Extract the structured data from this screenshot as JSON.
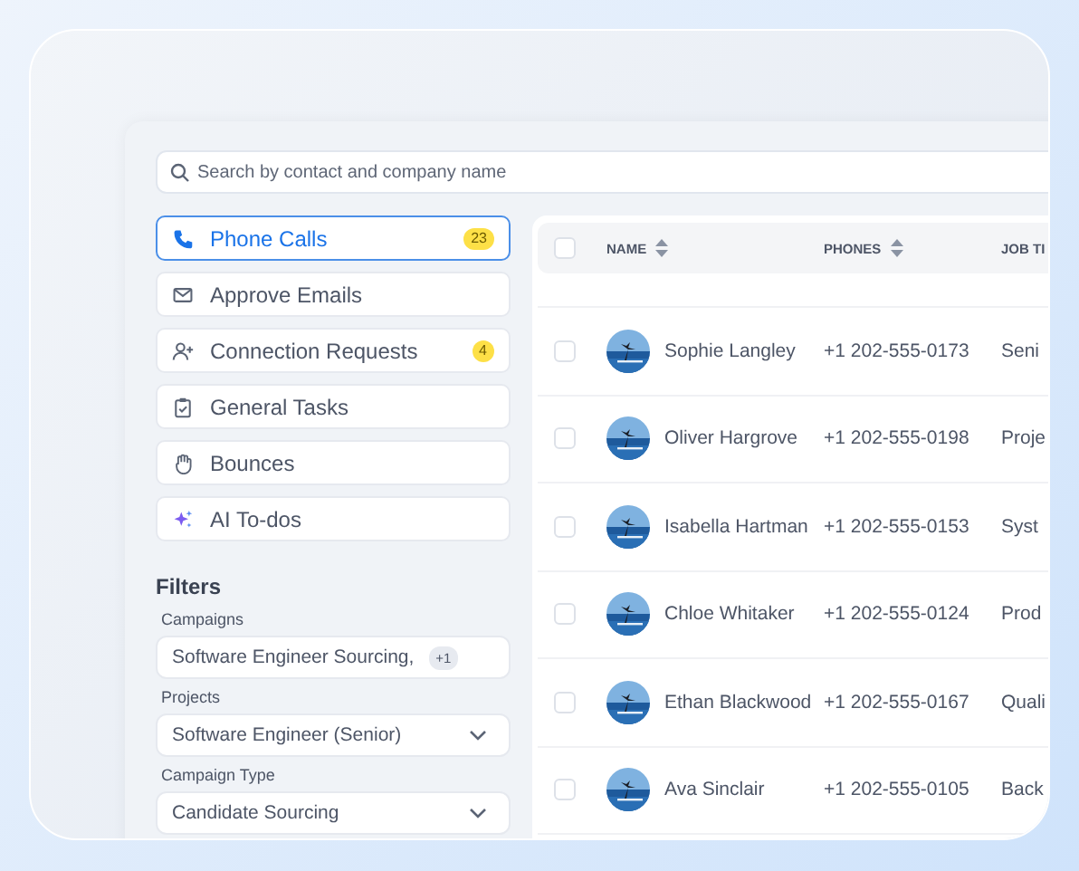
{
  "search": {
    "placeholder": "Search by contact and company name"
  },
  "tasks": [
    {
      "kind": "phone",
      "label": "Phone Calls",
      "count": "23",
      "selected": true
    },
    {
      "kind": "mail",
      "label": "Approve Emails",
      "selected": false
    },
    {
      "kind": "person",
      "label": "Connection Requests",
      "count": "4",
      "selected": false
    },
    {
      "kind": "clipboard",
      "label": "General Tasks",
      "selected": false
    },
    {
      "kind": "hand",
      "label": "Bounces",
      "selected": false
    },
    {
      "kind": "sparkle",
      "label": "AI To-dos",
      "selected": false
    }
  ],
  "filters": {
    "title": "Filters",
    "fields": [
      {
        "label": "Campaigns",
        "value": "Software Engineer Sourcing,",
        "extra": "+1"
      },
      {
        "label": "Projects",
        "value": "Software Engineer (Senior)"
      },
      {
        "label": "Campaign Type",
        "value": "Candidate Sourcing"
      }
    ]
  },
  "table": {
    "all_checked": false,
    "columns": [
      "NAME",
      "PHONES",
      "JOB TI"
    ],
    "rows": [
      {
        "name": "Sophie Langley",
        "phone": "+1 202-555-0173",
        "job_title": "Seni",
        "checked": false
      },
      {
        "name": "Oliver Hargrove",
        "phone": "+1 202-555-0198",
        "job_title": "Proje",
        "checked": false
      },
      {
        "name": "Isabella Hartman",
        "phone": "+1 202-555-0153",
        "job_title": "Syst",
        "checked": false
      },
      {
        "name": "Chloe Whitaker",
        "phone": "+1 202-555-0124",
        "job_title": "Prod",
        "checked": false
      },
      {
        "name": "Ethan Blackwood",
        "phone": "+1 202-555-0167",
        "job_title": "Quali",
        "checked": false
      },
      {
        "name": "Ava Sinclair",
        "phone": "+1 202-555-0105",
        "job_title": "Back",
        "checked": false
      }
    ]
  }
}
